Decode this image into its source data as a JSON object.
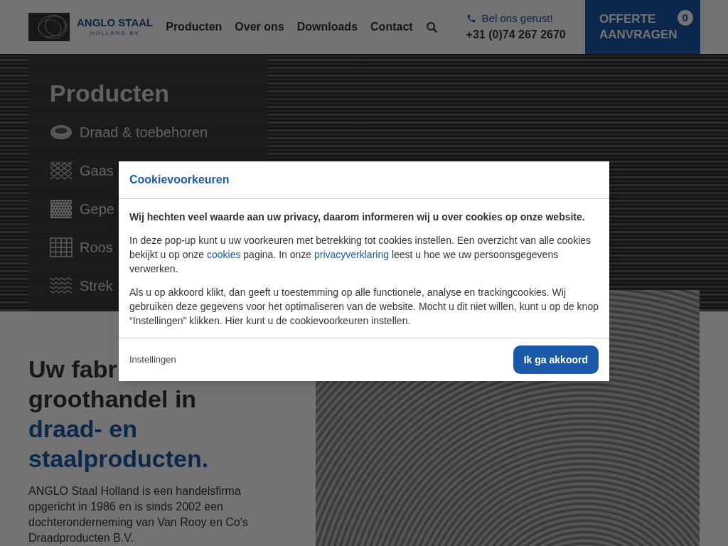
{
  "header": {
    "logo": {
      "name": "ANGLO STAAL",
      "sub": "HOLLAND BV"
    },
    "nav": [
      "Producten",
      "Over ons",
      "Downloads",
      "Contact"
    ],
    "phone": {
      "label": "Bel ons gerust!",
      "number": "+31 (0)74 267 2670"
    },
    "quote_button": {
      "lines": [
        "OFFERTE",
        "AANVRAGEN"
      ],
      "count": "0"
    }
  },
  "products_panel": {
    "title": "Producten",
    "items": [
      {
        "label": "Draad & toebehoren",
        "kind": "coil"
      },
      {
        "label": "Gaas",
        "kind": "mesh"
      },
      {
        "label": "Gepe",
        "kind": "perforated"
      },
      {
        "label": "Roos",
        "kind": "grid"
      },
      {
        "label": "Strek",
        "kind": "expanded"
      }
    ]
  },
  "intro": {
    "heading": [
      {
        "text": "Uw fabr",
        "accent": false
      },
      {
        "text": "groothandel in",
        "accent": false
      },
      {
        "text": "draad- en",
        "accent": true
      },
      {
        "text": "staalproducten.",
        "accent": true
      }
    ],
    "paragraph": "ANGLO Staal Holland is een handelsfirma opgericht in 1986 en is sinds 2002 een dochteronderneming van Van Rooy en Co's Draadproducten B.V."
  },
  "cookie_dialog": {
    "title": "Cookievoorkeuren",
    "lead": "Wij hechten veel waarde aan uw privacy, daarom informeren wij u over cookies op onze website.",
    "paragraphs": [
      [
        {
          "text": "In deze pop-up kunt u uw voorkeuren met betrekking tot cookies instellen. Een overzicht van alle cookies bekijkt u op onze ",
          "link": false
        },
        {
          "text": "cookies",
          "link": true
        },
        {
          "text": " pagina. In onze ",
          "link": false
        },
        {
          "text": "privacyverklaring",
          "link": true
        },
        {
          "text": " leest u hoe we uw persoonsgegevens verwerken.",
          "link": false
        }
      ],
      [
        {
          "text": "Als u op akkoord klikt, dan geeft u toestemming op alle functionele, analyse en trackingcookies. Wij gebruiken deze gegevens voor het optimaliseren van de website. Mocht u dit niet willen, kunt u op de knop “Instellingen” klikken. Hier kunt u de cookievoorkeuren instellen.",
          "link": false
        }
      ]
    ],
    "settings_button": "Instellingen",
    "accept_button": "Ik ga akkoord"
  }
}
